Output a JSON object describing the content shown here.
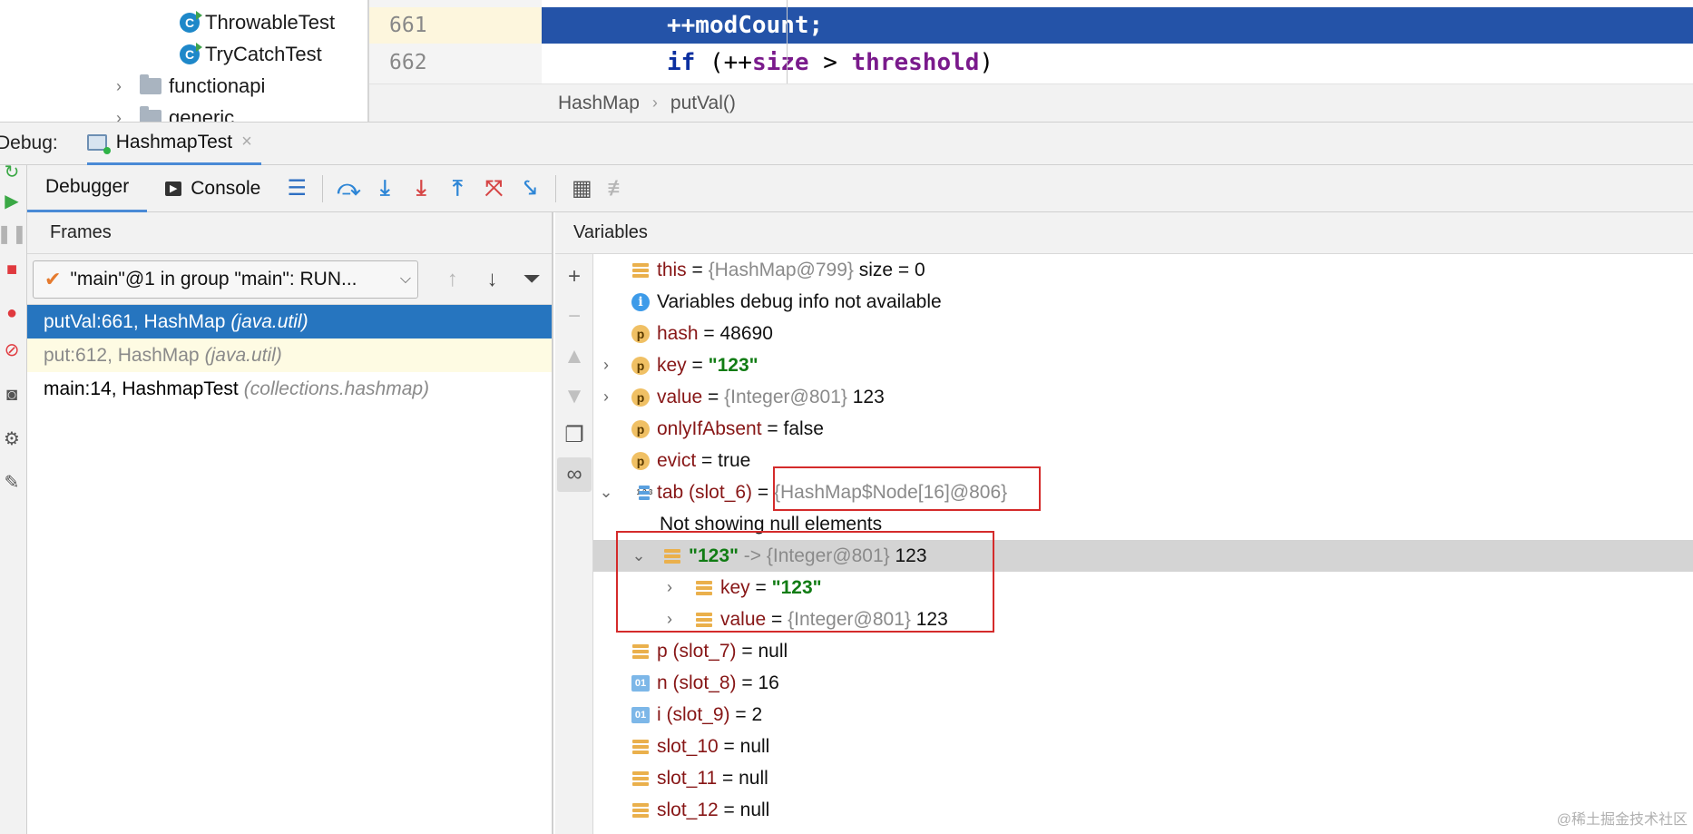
{
  "project_tree": {
    "items": [
      {
        "label": "ThrowableTest",
        "kind": "class"
      },
      {
        "label": "TryCatchTest",
        "kind": "class"
      },
      {
        "label": "functionapi",
        "kind": "folder"
      },
      {
        "label": "generic",
        "kind": "folder"
      }
    ]
  },
  "editor": {
    "lines": [
      {
        "number": "661",
        "code": "++modCount;"
      },
      {
        "number": "662",
        "code_parts": [
          "if",
          " (++",
          "size",
          " > ",
          "threshold",
          ")"
        ]
      }
    ],
    "breadcrumb": [
      "HashMap",
      "putVal()"
    ]
  },
  "debug": {
    "label": "Debug:",
    "tab_label": "HashmapTest",
    "tab_close": "×"
  },
  "toolbar": {
    "tabs": [
      "Debugger",
      "Console"
    ],
    "console_icon": "▶"
  },
  "frames": {
    "header": "Frames",
    "thread": "\"main\"@1 in group \"main\": RUN...",
    "rows": [
      {
        "method": "putVal:661, HashMap",
        "pkg": "(java.util)",
        "state": "selected"
      },
      {
        "method": "put:612, HashMap",
        "pkg": "(java.util)",
        "state": "library"
      },
      {
        "method": "main:14, HashmapTest",
        "pkg": "(collections.hashmap)",
        "state": "normal"
      }
    ]
  },
  "variables": {
    "header": "Variables",
    "rows": [
      {
        "icon": "field-icon",
        "name": "this",
        "eq": " = ",
        "ref": "{HashMap@799}",
        "val": "  size = 0"
      },
      {
        "icon": "info-icon",
        "plain": "Variables debug info not available"
      },
      {
        "icon": "param-icon",
        "name": "hash",
        "eq": " = ",
        "val": "48690"
      },
      {
        "icon": "param-icon",
        "expander": "›",
        "name": "key",
        "eq": " = ",
        "str": "\"123\""
      },
      {
        "icon": "param-icon",
        "expander": "›",
        "name": "value",
        "eq": " = ",
        "ref": "{Integer@801}",
        "val": " 123"
      },
      {
        "icon": "param-icon",
        "name": "onlyIfAbsent",
        "eq": " = ",
        "val": "false"
      },
      {
        "icon": "param-icon",
        "name": "evict",
        "eq": " = ",
        "val": "true"
      },
      {
        "icon": "array-icon",
        "expander": "⌄",
        "name": "tab (slot_6)",
        "eq": " = ",
        "ref": "{HashMap$Node[16]@806}"
      },
      {
        "plain": "Not showing null elements"
      },
      {
        "icon": "field-icon",
        "expander": "⌄",
        "str": "\"123\"",
        "arrow": " -> ",
        "ref": "{Integer@801}",
        "val": " 123"
      },
      {
        "icon": "field-icon",
        "expander": "›",
        "name": "key",
        "eq": " = ",
        "str": "\"123\""
      },
      {
        "icon": "field-icon",
        "expander": "›",
        "name": "value",
        "eq": " = ",
        "ref": "{Integer@801}",
        "val": " 123"
      },
      {
        "icon": "field-icon",
        "name": "p (slot_7)",
        "eq": " = ",
        "val": "null"
      },
      {
        "icon": "primitive-icon",
        "name": "n (slot_8)",
        "eq": " = ",
        "val": "16"
      },
      {
        "icon": "primitive-icon",
        "name": "i (slot_9)",
        "eq": " = ",
        "val": "2"
      },
      {
        "icon": "field-icon",
        "name": "slot_10",
        "eq": " = ",
        "val": "null"
      },
      {
        "icon": "field-icon",
        "name": "slot_11",
        "eq": " = ",
        "val": "null"
      },
      {
        "icon": "field-icon",
        "name": "slot_12",
        "eq": " = ",
        "val": "null"
      }
    ]
  },
  "icons": {
    "class_letter": "C",
    "param_letter": "p",
    "info_letter": "i",
    "primitive_label": "01",
    "array_label": "1 2 3"
  },
  "watermark": "@稀土掘金技术社区",
  "colors": {
    "execution_line": "#2453a8",
    "selected_frame": "#2675bf",
    "highlight_box": "#d42b2b",
    "string_value": "#117c14",
    "var_name": "#871616"
  }
}
